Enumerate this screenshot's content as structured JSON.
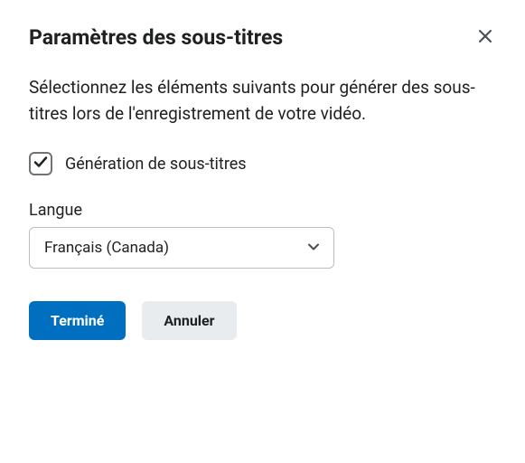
{
  "dialog": {
    "title": "Paramètres des sous-titres",
    "description": "Sélectionnez les éléments suivants pour générer des sous-titres lors de l'enregistrement de votre vidéo."
  },
  "checkbox": {
    "label": "Génération de sous-titres",
    "checked": true
  },
  "language": {
    "label": "Langue",
    "selected": "Français (Canada)"
  },
  "buttons": {
    "done": "Terminé",
    "cancel": "Annuler"
  }
}
